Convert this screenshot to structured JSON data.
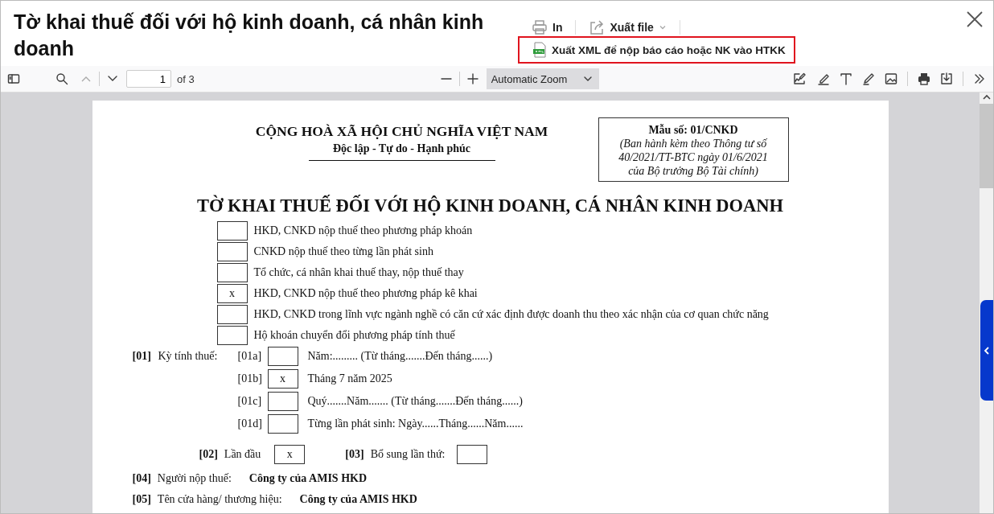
{
  "header": {
    "title": "Tờ khai thuế đối với hộ kinh doanh, cá nhân kinh doanh",
    "print_button": "In",
    "export_button": "Xuất file",
    "export_xml_button": {
      "label": "Xuất XML để nộp báo cáo hoặc NK vào HTKK",
      "highlighted": true
    }
  },
  "toolbar": {
    "page_number": "1",
    "page_count": "of 3",
    "zoom": "Automatic Zoom"
  },
  "document": {
    "national_title": "CỘNG HOÀ XÃ HỘI CHỦ NGHĨA VIỆT NAM",
    "motto": "Độc lập - Tự do - Hạnh phúc",
    "form_box": {
      "code": "Mẫu số: 01/CNKD",
      "note_lines": [
        "(Ban hành kèm theo Thông tư số",
        "40/2021/TT-BTC ngày 01/6/2021",
        "của Bộ trưởng Bộ Tài chính)"
      ]
    },
    "form_title": "TỜ KHAI THUẾ ĐỐI VỚI HỘ KINH DOANH, CÁ NHÂN KINH DOANH",
    "taxpayer_types": [
      {
        "label": "HKD, CNKD nộp thuế theo phương pháp khoán",
        "checked": false
      },
      {
        "label": "CNKD nộp thuế theo từng lần phát sinh",
        "checked": false
      },
      {
        "label": "Tổ chức, cá nhân khai thuế thay, nộp thuế thay",
        "checked": false
      },
      {
        "label": "HKD, CNKD nộp thuế theo phương pháp kê khai",
        "checked": true,
        "mark": "x"
      },
      {
        "label": "HKD, CNKD trong lĩnh vực ngành nghề có căn cứ xác định được doanh thu theo xác nhận của cơ quan chức năng",
        "checked": false
      },
      {
        "label": "Hộ khoán chuyển đổi phương pháp tính thuế",
        "checked": false
      }
    ],
    "tax_period": {
      "code": "[01]",
      "label": "Kỳ tính thuế:",
      "options": [
        {
          "code": "[01a]",
          "text": "Năm:......... (Từ tháng.......Đến tháng......)",
          "checked": false
        },
        {
          "code": "[01b]",
          "text": "Tháng 7 năm 2025",
          "checked": true,
          "mark": "x"
        },
        {
          "code": "[01c]",
          "text": "Quý.......Năm....... (Từ tháng.......Đến tháng......)",
          "checked": false
        },
        {
          "code": "[01d]",
          "text": "Từng lần phát sinh: Ngày......Tháng......Năm......",
          "checked": false
        }
      ]
    },
    "first_time": {
      "code": "[02]",
      "label": "Lần đầu",
      "checked": true,
      "mark": "x"
    },
    "supplement": {
      "code": "[03]",
      "label": "Bổ sung lần thứ:"
    },
    "fields": [
      {
        "code": "[04]",
        "label": "Người nộp thuế:",
        "value": "Công ty của AMIS HKD"
      },
      {
        "code": "[05]",
        "label": "Tên cửa hàng/ thương hiệu:",
        "value": "Công ty của AMIS HKD"
      }
    ]
  }
}
